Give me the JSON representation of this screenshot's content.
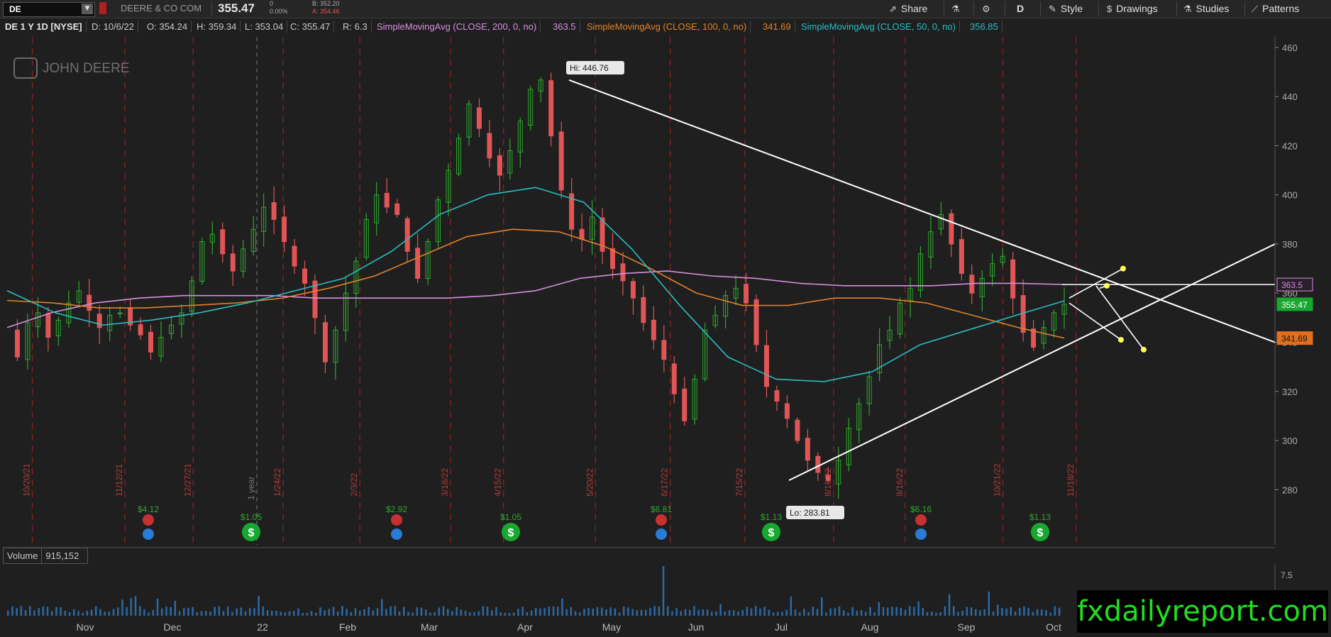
{
  "header": {
    "symbol": "DE",
    "company": "DEERE & CO COM",
    "last": "355.47",
    "change": "0",
    "change_pct": "0.00%",
    "bid": "B: 352.20",
    "ask": "A: 354.46",
    "toolbar": {
      "share": "Share",
      "period": "D",
      "style": "Style",
      "drawings": "Drawings",
      "studies": "Studies",
      "patterns": "Patterns"
    }
  },
  "info": {
    "title": "DE 1 Y 1D [NYSE]",
    "date": "D: 10/6/22",
    "open": "O: 354.24",
    "high": "H: 359.34",
    "low": "L: 353.04",
    "close": "C: 355.47",
    "range": "R: 6.3",
    "sma200_label": "SimpleMovingAvg (CLOSE, 200, 0, no)",
    "sma200_value": "363.5",
    "sma100_label": "SimpleMovingAvg (CLOSE, 100, 0, no)",
    "sma100_value": "341.69",
    "sma50_label": "SimpleMovingAvg (CLOSE, 50, 0, no)",
    "sma50_value": "356.85"
  },
  "volume": {
    "label": "Volume",
    "value": "915,152",
    "axis_label": "7.5"
  },
  "logo": {
    "text": "JOHN DEERE"
  },
  "watermark": "fxdailyreport.com",
  "colors": {
    "background": "#1f1f1f",
    "up": "#2ea82e",
    "down": "#e05555",
    "sma200": "#d78ee0",
    "sma100": "#e0822a",
    "sma50": "#2bbcc2",
    "trendline": "#ffffff",
    "arrow_head": "#ffff55"
  },
  "chart_data": {
    "type": "candlestick",
    "symbol": "DE",
    "ylim": [
      270,
      465
    ],
    "y_ticks": [
      280,
      300,
      320,
      340,
      360,
      380,
      400,
      420,
      440,
      460
    ],
    "x_month_labels": [
      "Nov",
      "Dec",
      "22",
      "Feb",
      "Mar",
      "Apr",
      "May",
      "Jun",
      "Jul",
      "Aug",
      "Sep",
      "Oct"
    ],
    "hi_label": "Hi: 446.76",
    "lo_label": "Lo: 283.81",
    "one_year_marker": "1 year",
    "event_dates": [
      "10/20/21",
      "11/12/21",
      "12/27/21",
      "1/24/22",
      "2/3/22",
      "3/18/22",
      "4/15/22",
      "5/20/22",
      "6/17/22",
      "7/15/22",
      "8/19/22",
      "9/16/22",
      "10/21/22",
      "11/18/22"
    ],
    "dividends": [
      {
        "label": "$1.05",
        "index": 0
      },
      {
        "label": "$1.05",
        "index": 1
      },
      {
        "label": "$1.13",
        "index": 2
      },
      {
        "label": "$1.13",
        "index": 3
      }
    ],
    "earnings": [
      {
        "label": "$4.12",
        "index": 0
      },
      {
        "label": "$2.92",
        "index": 1
      },
      {
        "label": "$6.81",
        "index": 2
      },
      {
        "label": "$6.16",
        "index": 3
      }
    ],
    "price_badges": [
      {
        "name": "sma200",
        "value": "363.5"
      },
      {
        "name": "last",
        "value": "355.47"
      },
      {
        "name": "sma100",
        "value": "341.69"
      }
    ],
    "series": [
      {
        "name": "SimpleMovingAvg (CLOSE, 200, 0, no)",
        "color": "#d78ee0",
        "values": [
          346,
          352,
          356,
          358,
          359,
          359,
          359,
          358,
          358,
          358,
          358,
          359,
          361,
          366,
          368,
          369,
          367,
          366,
          364,
          363,
          363,
          363,
          364,
          364,
          363.5
        ]
      },
      {
        "name": "SimpleMovingAvg (CLOSE, 100, 0, no)",
        "color": "#e0822a",
        "values": [
          357,
          356,
          354,
          354,
          355,
          356,
          358,
          362,
          367,
          375,
          383,
          386,
          385,
          379,
          370,
          360,
          355,
          355,
          358,
          358,
          356,
          351,
          346,
          341.69
        ]
      },
      {
        "name": "SimpleMovingAvg (CLOSE, 50, 0, no)",
        "color": "#2bbcc2",
        "values": [
          361,
          352,
          347,
          349,
          352,
          356,
          361,
          366,
          377,
          392,
          400,
          403,
          397,
          378,
          355,
          334,
          325,
          324,
          328,
          339,
          345,
          351,
          356.85
        ]
      }
    ],
    "price_path": [
      345,
      334,
      348,
      352,
      342,
      349,
      356,
      361,
      353,
      346,
      351,
      352,
      347,
      343,
      336,
      342,
      347,
      352,
      365,
      381,
      384,
      376,
      369,
      378,
      386,
      395,
      390,
      381,
      371,
      364,
      350,
      332,
      345,
      360,
      373,
      390,
      400,
      395,
      392,
      377,
      366,
      381,
      398,
      410,
      423,
      437,
      427,
      415,
      408,
      418,
      430,
      443,
      446.76,
      424,
      402,
      386,
      382,
      391,
      377,
      370,
      365,
      358,
      348,
      341,
      333,
      319,
      308,
      325,
      345,
      351,
      359,
      362,
      356,
      339,
      322,
      316,
      309,
      300,
      292,
      287,
      283.81,
      292,
      305,
      315,
      326,
      339,
      345,
      356,
      362,
      376,
      385,
      392,
      380,
      368,
      360,
      366,
      372,
      375,
      358,
      344,
      338,
      346,
      352,
      355.47
    ]
  }
}
